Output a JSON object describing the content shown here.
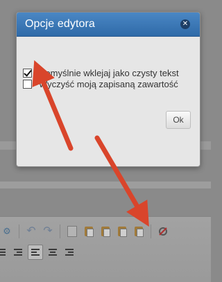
{
  "dialog": {
    "title": "Opcje edytora",
    "close_icon": "close-icon",
    "options": [
      {
        "label": "Domyślnie wklejaj jako czysty tekst",
        "checked": true
      },
      {
        "label": "Wyczyść moją zapisaną zawartość",
        "checked": false
      }
    ],
    "ok_label": "Ok"
  },
  "toolbar": {
    "row1_icons": [
      "find-replace-icon",
      "undo-icon",
      "redo-icon",
      "copy-icon",
      "paste-icon",
      "paste-text-icon",
      "paste-word-icon",
      "paste-image-icon",
      "editor-options-icon"
    ],
    "row2_icons": [
      "outdent-icon",
      "indent-icon",
      "align-left-icon",
      "align-center-icon",
      "align-right-icon"
    ]
  },
  "colors": {
    "header_blue": "#3a78b8",
    "annotation_red": "#d9452b",
    "dialog_bg": "#e6e6e6"
  }
}
